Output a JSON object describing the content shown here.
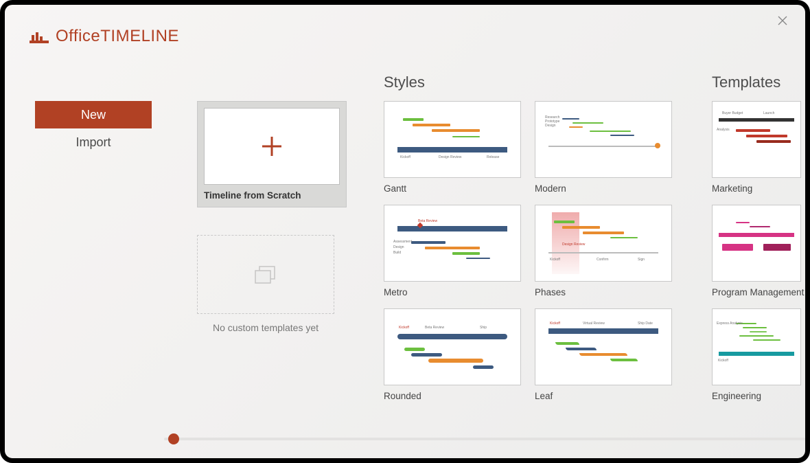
{
  "app": {
    "brand_light": "Office",
    "brand_bold": "TIMELINE"
  },
  "sidebar": {
    "items": [
      {
        "label": "New",
        "active": true
      },
      {
        "label": "Import",
        "active": false
      }
    ]
  },
  "create": {
    "scratch_label": "Timeline from Scratch",
    "custom_empty_label": "No custom templates yet"
  },
  "sections": {
    "styles_title": "Styles",
    "templates_title": "Templates"
  },
  "styles": [
    {
      "label": "Gantt"
    },
    {
      "label": "Modern"
    },
    {
      "label": "Metro"
    },
    {
      "label": "Phases"
    },
    {
      "label": "Rounded"
    },
    {
      "label": "Leaf"
    }
  ],
  "templates": [
    {
      "label": "Marketing"
    },
    {
      "label": "Program Management"
    },
    {
      "label": "Engineering"
    }
  ],
  "colors": {
    "brand": "#B14124",
    "accent_blue": "#3d5a80",
    "accent_green": "#6cbf3f",
    "accent_orange": "#e88c2f",
    "accent_red": "#c0392b",
    "accent_teal": "#179aa0",
    "accent_pink": "#d63384"
  }
}
